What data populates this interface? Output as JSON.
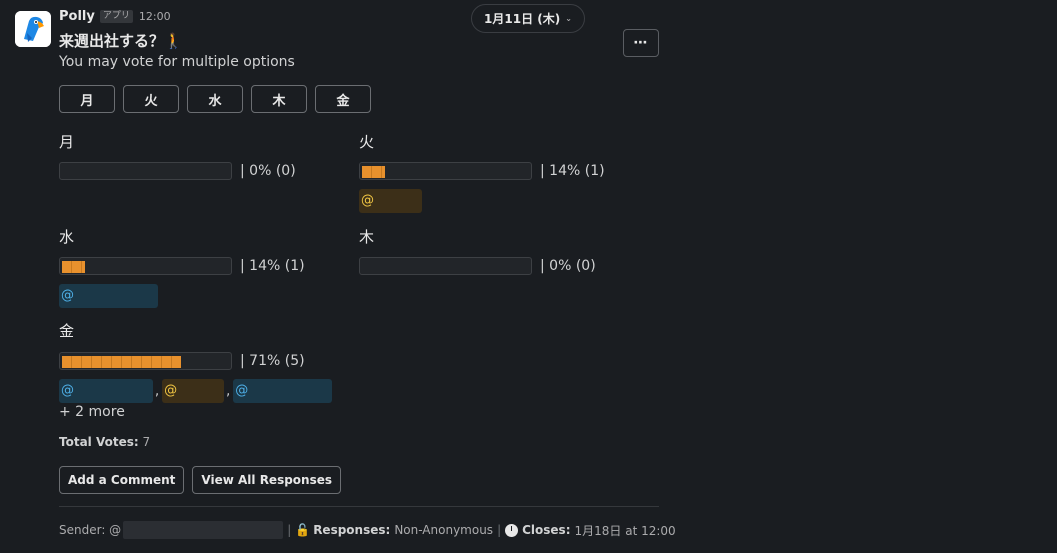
{
  "message": {
    "sender": "Polly",
    "badge": "アプリ",
    "time": "12:00",
    "date_divider": "1月11日 (木)",
    "more_label": "⋯",
    "title": "来週出社する？🚶",
    "subtitle": "You may vote for multiple options"
  },
  "vote_buttons": [
    "月",
    "火",
    "水",
    "木",
    "金"
  ],
  "options": [
    {
      "label": "月",
      "percent": 0,
      "result": "| 0% (0)",
      "mentions": []
    },
    {
      "label": "火",
      "percent": 14,
      "result": "| 14% (1)",
      "mentions": [
        {
          "text": "@",
          "color": "yellow"
        }
      ]
    },
    {
      "label": "水",
      "percent": 14,
      "result": "| 14% (1)",
      "mentions": [
        {
          "text": "@",
          "color": "blue"
        }
      ]
    },
    {
      "label": "木",
      "percent": 0,
      "result": "| 0% (0)",
      "mentions": []
    },
    {
      "label": "金",
      "percent": 71,
      "result": "| 71% (5)",
      "mentions": [
        {
          "text": "@",
          "color": "blue"
        },
        {
          "text": "@",
          "color": "yellow"
        },
        {
          "text": "@",
          "color": "blue"
        }
      ]
    }
  ],
  "more_mentions": "+ 2 more",
  "total_label": "Total Votes:",
  "total_value": "7",
  "actions": {
    "comment": "Add a Comment",
    "view_all": "View All Responses"
  },
  "footer": {
    "sender_label": "Sender: @",
    "responses_label": "Responses:",
    "responses_value": "Non-Anonymous",
    "closes_label": "Closes:",
    "closes_value": "1月18日 at 12:00"
  },
  "colors": {
    "accent_orange": "#e8912d",
    "mention_blue": "#4fb0e8",
    "mention_yellow": "#f2c744",
    "background": "#1a1d21"
  },
  "icons": {
    "avatar": "polly-parrot-icon",
    "lock": "lock-icon",
    "clock": "clock-icon"
  }
}
